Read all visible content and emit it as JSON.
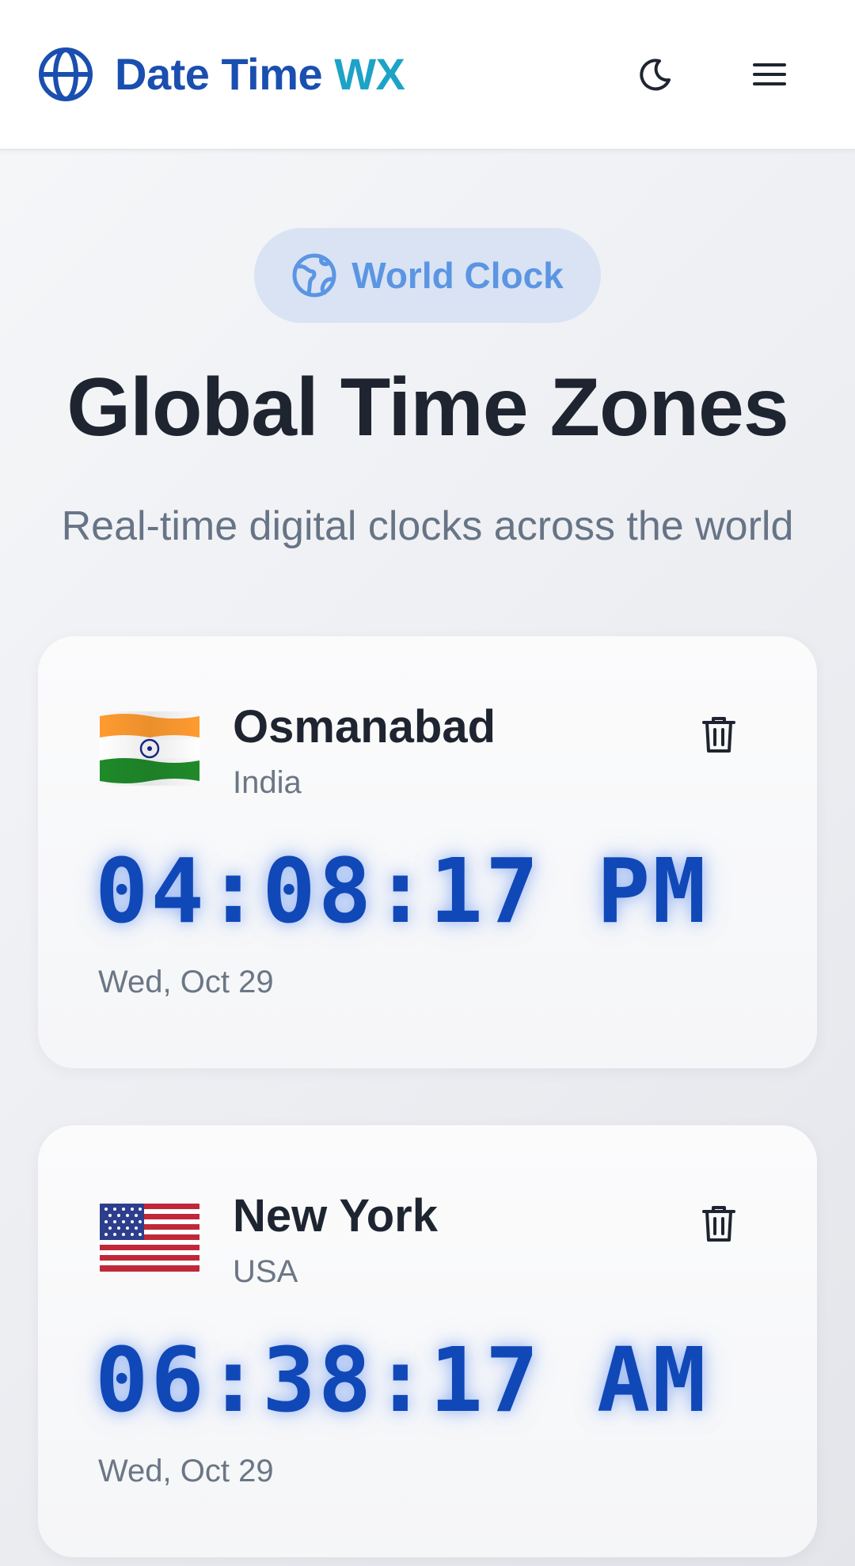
{
  "header": {
    "brand_part1": "Date Time",
    "brand_part2": "WX",
    "brand_icon": "globe-icon",
    "theme_icon": "moon-icon",
    "menu_icon": "hamburger-menu-icon"
  },
  "hero": {
    "badge_label": "World Clock",
    "badge_icon": "earth-icon",
    "title": "Global Time Zones",
    "subtitle": "Real-time digital clocks across the world"
  },
  "clocks": [
    {
      "city": "Osmanabad",
      "country": "India",
      "time": "04:08:17 PM",
      "date": "Wed, Oct 29",
      "flag_icon": "india-flag-icon"
    },
    {
      "city": "New York",
      "country": "USA",
      "time": "06:38:17 AM",
      "date": "Wed, Oct 29",
      "flag_icon": "usa-flag-icon"
    }
  ],
  "colors": {
    "brand_primary": "#1a4fb0",
    "brand_secondary": "#1ca3c7",
    "clock_digits": "#1148b8",
    "badge_bg": "#d9e3f4",
    "badge_text": "#5b95e3"
  }
}
